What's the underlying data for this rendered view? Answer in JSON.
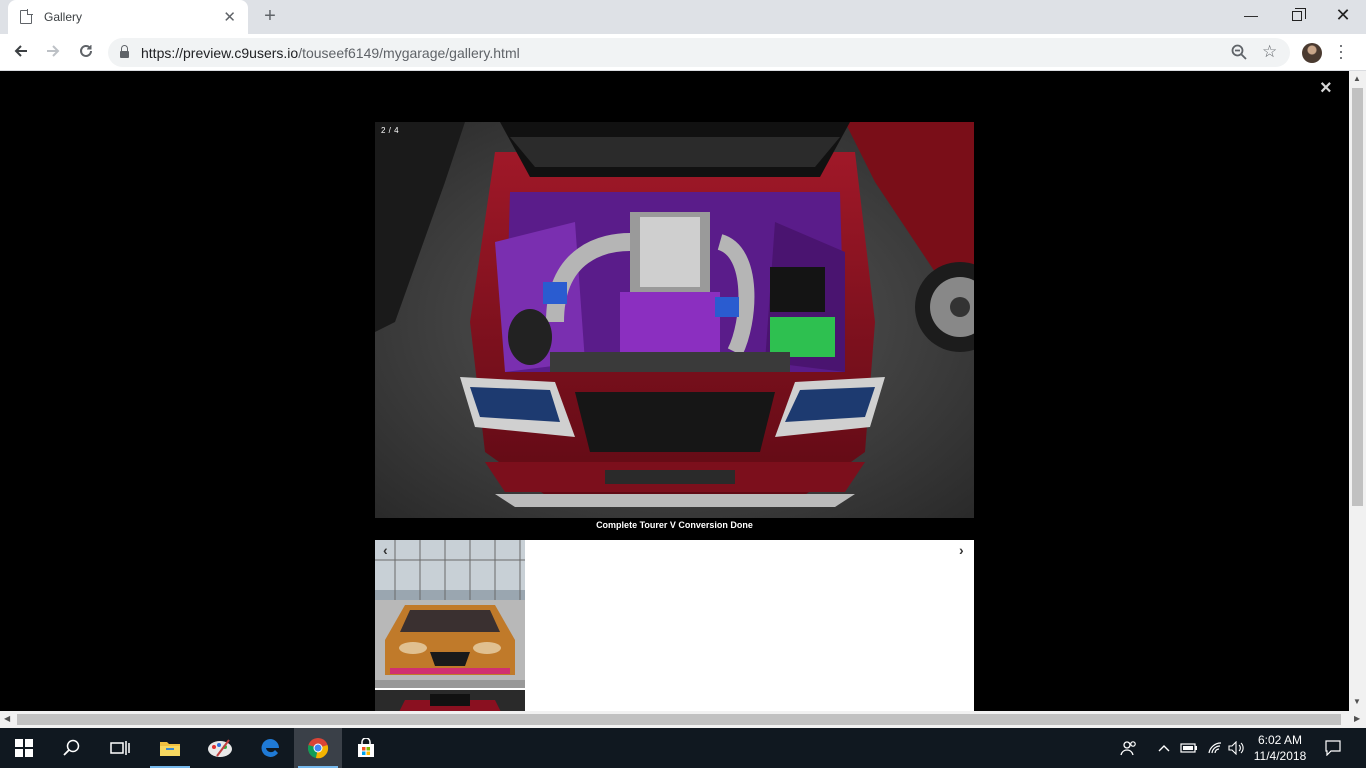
{
  "browser": {
    "tab_title": "Gallery",
    "url_host": "https://preview.c9users.io",
    "url_path": "/touseef6149/mygarage/gallery.html"
  },
  "lightbox": {
    "close_label": "×",
    "counter": "2 / 4",
    "caption": "Complete Tourer V Conversion Done",
    "prev_label": "‹",
    "next_label": "›"
  },
  "taskbar": {
    "time": "6:02 AM",
    "date": "11/4/2018",
    "pinned": [
      "windows-start-icon",
      "search-icon",
      "task-view-icon",
      "file-explorer-icon",
      "paint-app-icon",
      "edge-icon",
      "chrome-icon",
      "store-icon"
    ]
  },
  "colors": {
    "lightbox_bg": "#000000",
    "tabstrip_bg": "#dee1e6",
    "taskbar_bg": "#101820",
    "car_red": "#8a1020",
    "engine_purple": "#7a2fb0",
    "thumb_car_orange": "#c07a2a"
  }
}
